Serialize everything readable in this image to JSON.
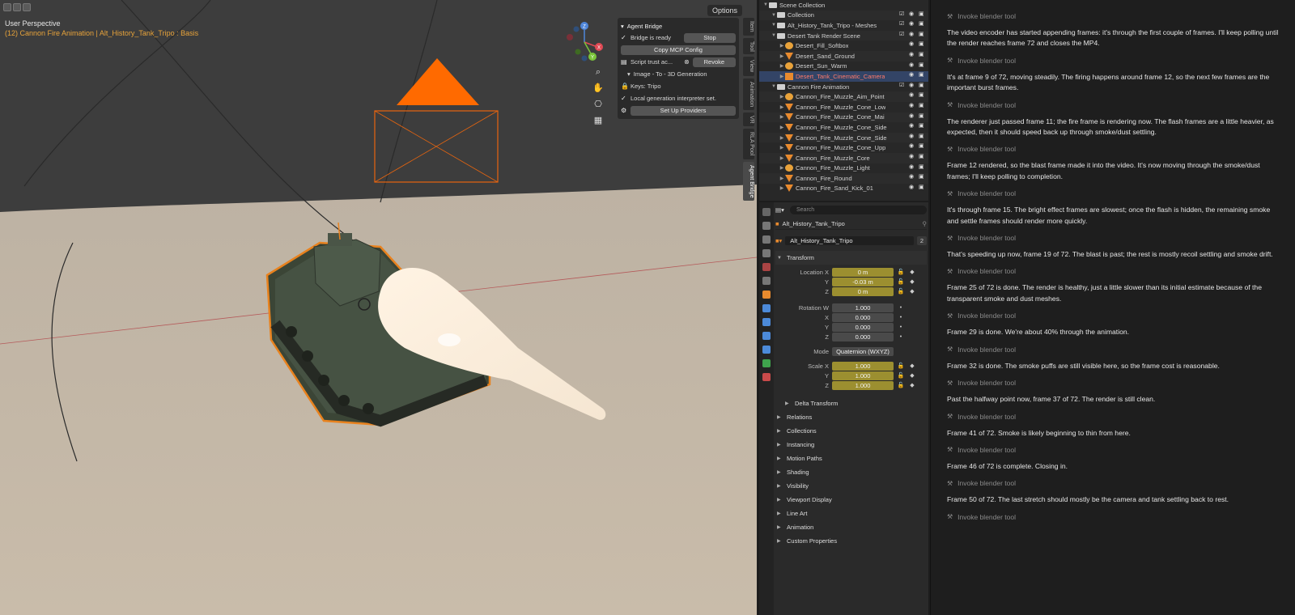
{
  "viewport": {
    "options_label": "Options",
    "title": "User Perspective",
    "subtitle": "(12) Cannon Fire Animation | Alt_History_Tank_Tripo : Basis",
    "gizmo": {
      "z": "Z",
      "x": "X",
      "y": "Y"
    }
  },
  "agent_panel": {
    "header": "Agent Bridge",
    "bridge_status": "Bridge is ready",
    "stop_label": "Stop",
    "copy_mcp": "Copy MCP Config",
    "script_trust": "Script trust ac...",
    "revoke": "Revoke",
    "image_to_3d": "Image - To - 3D Generation",
    "keys": "Keys: Tripo",
    "local_interp": "Local generation interpreter set.",
    "setup": "Set Up Providers"
  },
  "vertical_tabs": [
    "Item",
    "Tool",
    "View",
    "Animation",
    "VR",
    "RLA Pool",
    "Agent Bridge"
  ],
  "outliner": {
    "rows": [
      {
        "label": "Scene Collection",
        "icon": "scene",
        "indent": 0
      },
      {
        "label": "Collection",
        "icon": "collection",
        "indent": 1
      },
      {
        "label": "Alt_History_Tank_Tripo - Meshes",
        "icon": "collection",
        "indent": 1
      },
      {
        "label": "Desert Tank Render Scene",
        "icon": "collection",
        "indent": 1
      },
      {
        "label": "Desert_Fill_Softbox",
        "icon": "light",
        "indent": 2
      },
      {
        "label": "Desert_Sand_Ground",
        "icon": "object",
        "indent": 2
      },
      {
        "label": "Desert_Sun_Warm",
        "icon": "light",
        "indent": 2
      },
      {
        "label": "Desert_Tank_Cinematic_Camera",
        "icon": "camera",
        "indent": 2,
        "selected": true
      },
      {
        "label": "Cannon Fire Animation",
        "icon": "collection",
        "indent": 1
      },
      {
        "label": "Cannon_Fire_Muzzle_Aim_Point",
        "icon": "empty",
        "indent": 2
      },
      {
        "label": "Cannon_Fire_Muzzle_Cone_Low",
        "icon": "object",
        "indent": 2
      },
      {
        "label": "Cannon_Fire_Muzzle_Cone_Mai",
        "icon": "object",
        "indent": 2
      },
      {
        "label": "Cannon_Fire_Muzzle_Cone_Side",
        "icon": "object",
        "indent": 2
      },
      {
        "label": "Cannon_Fire_Muzzle_Cone_Side",
        "icon": "object",
        "indent": 2
      },
      {
        "label": "Cannon_Fire_Muzzle_Cone_Upp",
        "icon": "object",
        "indent": 2
      },
      {
        "label": "Cannon_Fire_Muzzle_Core",
        "icon": "object",
        "indent": 2
      },
      {
        "label": "Cannon_Fire_Muzzle_Light",
        "icon": "light",
        "indent": 2
      },
      {
        "label": "Cannon_Fire_Round",
        "icon": "object",
        "indent": 2
      },
      {
        "label": "Cannon_Fire_Sand_Kick_01",
        "icon": "object",
        "indent": 2
      }
    ]
  },
  "properties": {
    "search_placeholder": "Search",
    "object_name": "Alt_History_Tank_Tripo",
    "data_name": "Alt_History_Tank_Tripo",
    "user_count": "2",
    "transform_label": "Transform",
    "location_label": "Location X",
    "location": {
      "x": "0 m",
      "y": "-0.03 m",
      "z": "0 m"
    },
    "rotation_label": "Rotation W",
    "rotation": {
      "w": "1.000",
      "x": "0.000",
      "y": "0.000",
      "z": "0.000"
    },
    "mode_label": "Mode",
    "mode_value": "Quaternion (WXYZ)",
    "scale_label": "Scale X",
    "scale": {
      "x": "1.000",
      "y": "1.000",
      "z": "1.000"
    },
    "axis_y": "Y",
    "axis_z": "Z",
    "axis_x": "X",
    "delta_transform": "Delta Transform",
    "sections": [
      "Relations",
      "Collections",
      "Instancing",
      "Motion Paths",
      "Shading",
      "Visibility",
      "Viewport Display",
      "Line Art",
      "Animation",
      "Custom Properties"
    ]
  },
  "chat": {
    "tool_label": "Invoke blender tool",
    "messages": [
      "The video encoder has started appending frames: it's through the first couple of frames. I'll keep polling until the render reaches frame 72 and closes the MP4.",
      "It's at frame 9 of 72, moving steadily. The firing happens around frame 12, so the next few frames are the important burst frames.",
      "The renderer just passed frame 11; the fire frame is rendering now. The flash frames are a little heavier, as expected, then it should speed back up through smoke/dust settling.",
      "Frame 12 rendered, so the blast frame made it into the video. It's now moving through the smoke/dust frames; I'll keep polling to completion.",
      "It's through frame 15. The bright effect frames are slowest; once the flash is hidden, the remaining smoke and settle frames should render more quickly.",
      "That's speeding up now, frame 19 of 72. The blast is past; the rest is mostly recoil settling and smoke drift.",
      "Frame 25 of 72 is done. The render is healthy, just a little slower than its initial estimate because of the transparent smoke and dust meshes.",
      "Frame 29 is done. We're about 40% through the animation.",
      "Frame 32 is done. The smoke puffs are still visible here, so the frame cost is reasonable.",
      "Past the halfway point now, frame 37 of 72. The render is still clean.",
      "Frame 41 of 72. Smoke is likely beginning to thin from here.",
      "Frame 46 of 72 is complete. Closing in.",
      "Frame 50 of 72. The last stretch should mostly be the camera and tank settling back to rest."
    ]
  },
  "colors": {
    "selection_outline": "#e8821e",
    "camera_orange": "#ff6a00",
    "keyframe_yellow": "#9c8f30",
    "sand": "#c9bcaa"
  }
}
